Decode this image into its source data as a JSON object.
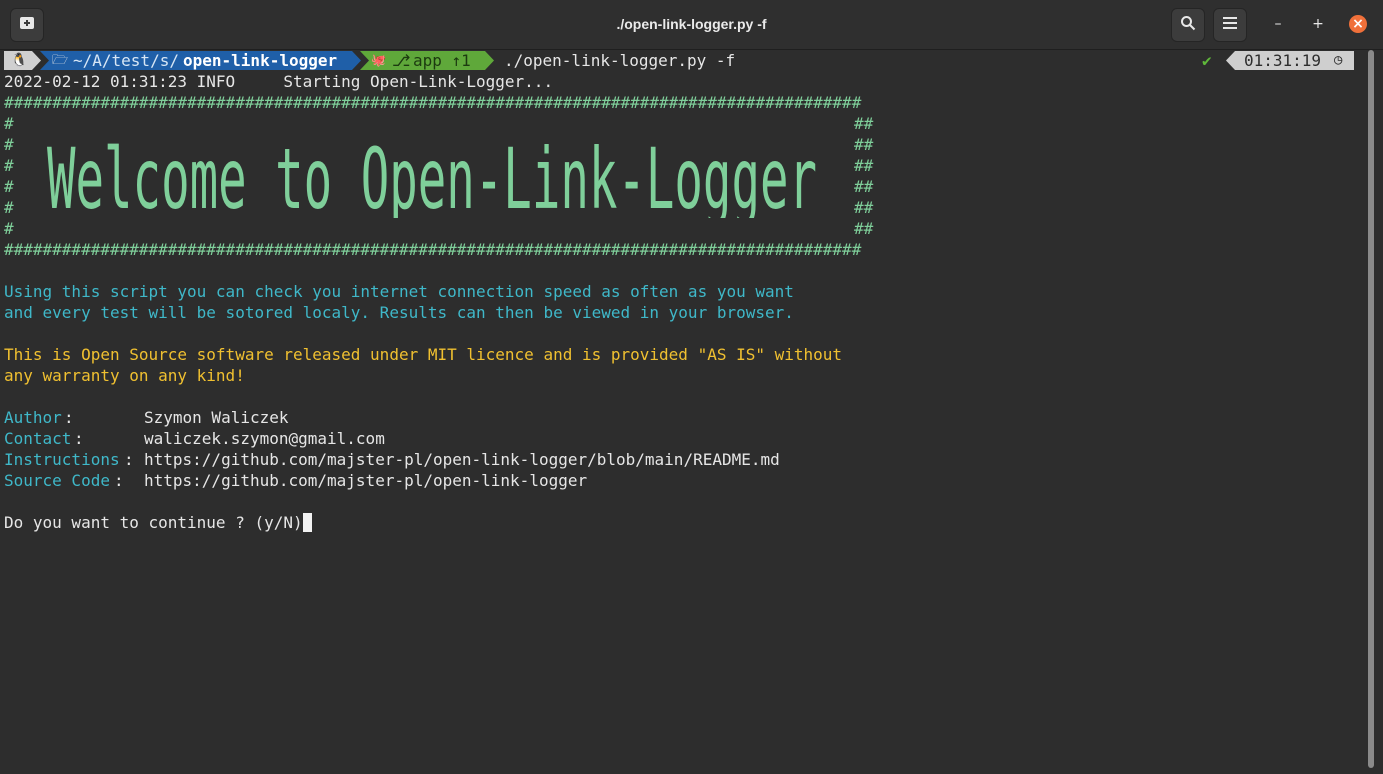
{
  "window": {
    "title": "./open-link-logger.py -f",
    "buttons": {
      "new_tab": "new-tab-icon",
      "search": "search-icon",
      "menu": "hamburger-menu-icon",
      "minimize": "–",
      "maximize": "+",
      "close": "×"
    },
    "close_color": "#f0703a"
  },
  "prompt": {
    "os_icon": "🐧",
    "folder_icon": "🗁",
    "path_prefix": "~/A/test/s/",
    "path_dir": "open-link-logger",
    "git_icon": "🐙",
    "branch_icon": "⎇",
    "branch": "app ↑1",
    "command": "./open-link-logger.py -f",
    "status": "✔",
    "time": "01:31:19",
    "clock_icon": "◷",
    "colors": {
      "os": "#cfcfcf",
      "path": "#1f5fa8",
      "git": "#5fa83a",
      "time": "#cfcfcf"
    }
  },
  "output": {
    "log_line": "2022-02-12 01:31:23 INFO     Starting Open-Link-Logger...",
    "hash_line": "#########################################################################################",
    "hash_side_left": "#",
    "hash_side_right": "##",
    "banner_text": "Welcome to Open-Link-Logger",
    "info_1": "Using this script you can check you internet connection speed as often as you want",
    "info_2": "and every test will be sotored localy. Results can then be viewed in your browser.",
    "license_1": "This is Open Source software released under MIT licence and is provided \"AS IS\" without",
    "license_2": "any warranty on any kind!",
    "author_label": "Author",
    "author_colon": ":",
    "author_value": "Szymon Waliczek",
    "contact_label": "Contact",
    "contact_colon": ":",
    "contact_value": "waliczek.szymon@gmail.com",
    "instructions_label": "Instructions",
    "instructions_colon": ":",
    "instructions_value": "https://github.com/majster-pl/open-link-logger/blob/main/README.md",
    "source_label": "Source Code",
    "source_colon": ":",
    "source_value": "https://github.com/majster-pl/open-link-logger",
    "question": "Do you want to continue ? (y/N)"
  },
  "colors": {
    "green": "#7fcf9a",
    "cyan": "#3fb8c9",
    "yellow": "#f0c030",
    "text": "#e6e6e6",
    "bg": "#2d2d2d"
  }
}
